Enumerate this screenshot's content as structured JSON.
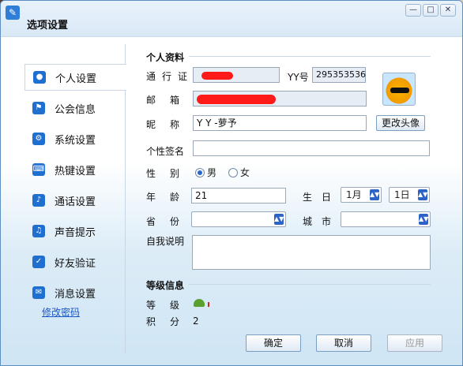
{
  "window": {
    "title": "选项设置",
    "controls": {
      "minimize": "—",
      "maximize": "□",
      "close": "✕"
    }
  },
  "sidebar": {
    "items": [
      {
        "label": "个人设置",
        "icon": "user-icon"
      },
      {
        "label": "公会信息",
        "icon": "flag-icon"
      },
      {
        "label": "系统设置",
        "icon": "gear-icon"
      },
      {
        "label": "热键设置",
        "icon": "key-icon"
      },
      {
        "label": "通话设置",
        "icon": "microphone-icon"
      },
      {
        "label": "声音提示",
        "icon": "speaker-icon"
      },
      {
        "label": "好友验证",
        "icon": "shield-user-icon"
      },
      {
        "label": "消息设置",
        "icon": "message-icon"
      }
    ],
    "change_password_link": "修改密码"
  },
  "profile": {
    "section_title": "个人资料",
    "pass_label": "通行证",
    "yy_label": "YY号",
    "yy_value": "295353536",
    "email_label": "邮箱",
    "nickname_label": "昵称",
    "nickname_value": "Y Y -萝予",
    "change_avatar": "更改头像",
    "signature_label": "个性签名",
    "signature_value": "",
    "gender_label": "性别",
    "gender_male": "男",
    "gender_female": "女",
    "age_label": "年龄",
    "age_value": "21",
    "birthday_label": "生日",
    "birth_month": "1月",
    "birth_day": "1日",
    "province_label": "省份",
    "province_value": "",
    "city_label": "城市",
    "city_value": "",
    "bio_label": "自我说明",
    "bio_value": ""
  },
  "level": {
    "section_title": "等级信息",
    "level_label": "等级",
    "points_label": "积分",
    "points_value": "2"
  },
  "buttons": {
    "ok": "确定",
    "cancel": "取消",
    "apply": "应用"
  },
  "colors": {
    "accent": "#1f6fd1",
    "redaction": "#ff1a1a",
    "link": "#1a58c8"
  }
}
